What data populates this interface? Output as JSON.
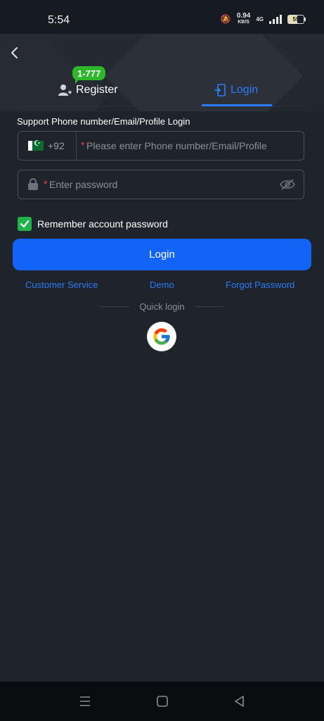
{
  "status_bar": {
    "time": "5:54",
    "speed_value": "0.94",
    "speed_unit": "KB/S",
    "network": "4G",
    "battery": "59"
  },
  "tabs": {
    "register_label": "Register",
    "login_label": "Login",
    "badge": "1-777",
    "active": "login",
    "active_color": "#2e7bf6"
  },
  "form": {
    "support_label": "Support Phone number/Email/Profile Login",
    "country_code": "+92",
    "phone_placeholder": "Please enter Phone number/Email/Profile",
    "password_placeholder": "Enter password",
    "required_mark": "*",
    "remember_label": "Remember account password",
    "remember_checked": true,
    "login_button": "Login"
  },
  "links": {
    "customer_service": "Customer Service",
    "demo": "Demo",
    "forgot_password": "Forgot Password"
  },
  "quick_login": {
    "label": "Quick login",
    "provider_icon": "google-icon"
  },
  "colors": {
    "background": "#1e232c",
    "accent": "#1164f6",
    "badge": "#2eb62c",
    "checkbox": "#22b24c",
    "required": "#e94747"
  }
}
